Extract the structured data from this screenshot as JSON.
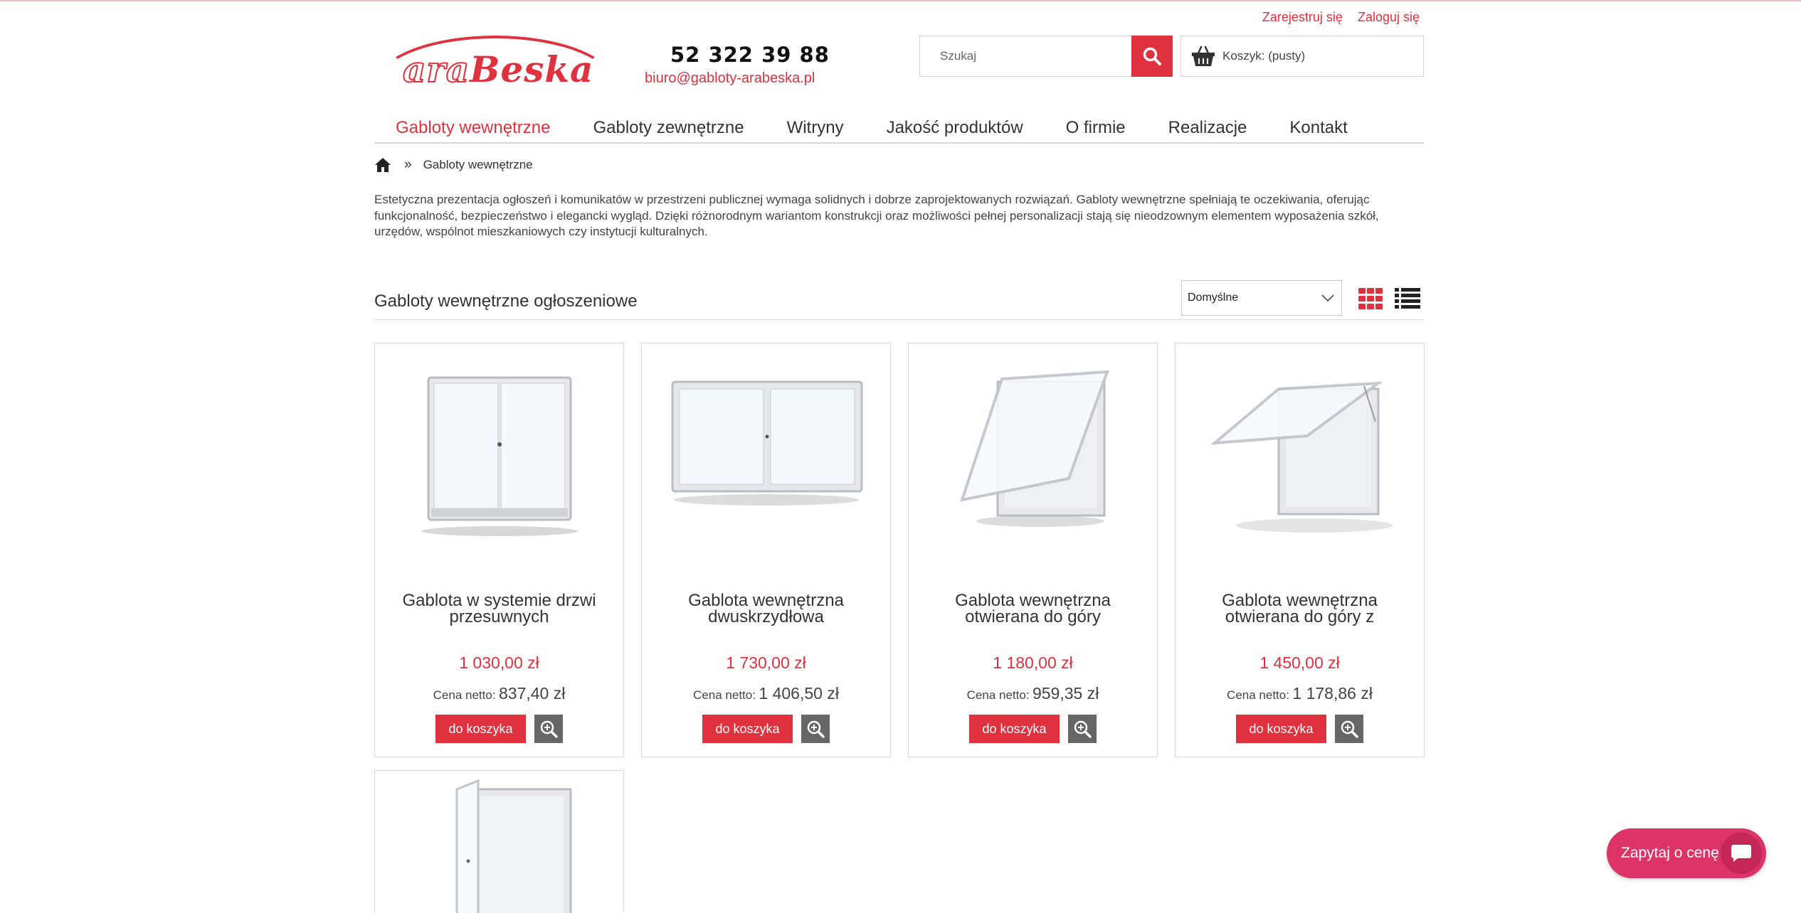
{
  "header": {
    "register_link": "Zarejestruj się",
    "login_link": "Zaloguj się",
    "logo_prefix": "ara",
    "logo_main": "Beska",
    "phone": "52 322 39 88",
    "email": "biuro@gabloty-arabeska.pl",
    "search_placeholder": "Szukaj",
    "cart_label": "Koszyk: (pusty)"
  },
  "nav": {
    "items": [
      {
        "label": "Gabloty wewnętrzne"
      },
      {
        "label": "Gabloty zewnętrzne"
      },
      {
        "label": "Witryny"
      },
      {
        "label": "Jakość produktów"
      },
      {
        "label": "O firmie"
      },
      {
        "label": "Realizacje"
      },
      {
        "label": "Kontakt"
      }
    ],
    "active": "Gabloty wewnętrzne"
  },
  "breadcrumb": {
    "separator": "»",
    "current": "Gabloty wewnętrzne"
  },
  "description": "Estetyczna prezentacja ogłoszeń i komunikatów w przestrzeni publicznej wymaga solidnych i dobrze zaprojektowanych rozwiązań. Gabloty wewnętrzne spełniają te oczekiwania, oferując funkcjonalność, bezpieczeństwo i elegancki wygląd. Dzięki różnorodnym wariantom konstrukcji oraz możliwości pełnej personalizacji stają się nieodzownym elementem wyposażenia szkół, urzędów, wspólnot mieszkaniowych czy instytucji kulturalnych.",
  "listing": {
    "title": "Gabloty wewnętrzne ogłoszeniowe",
    "sort_value": "Domyślne",
    "netto_label": "Cena netto:",
    "buy_label": "do koszyka"
  },
  "products": [
    {
      "name": "Gablota w systemie drzwi przesuwnych",
      "price": "1 030,00 zł",
      "netto": "837,40 zł"
    },
    {
      "name": "Gablota wewnętrzna dwuskrzydłowa",
      "price": "1 730,00 zł",
      "netto": "1 406,50 zł"
    },
    {
      "name": "Gablota wewnętrzna otwierana do góry",
      "price": "1 180,00 zł",
      "netto": "959,35 zł"
    },
    {
      "name": "Gablota wewnętrzna otwierana do góry z",
      "price": "1 450,00 zł",
      "netto": "1 178,86 zł"
    }
  ],
  "chat": {
    "label": "Zapytaj o cenę"
  },
  "colors": {
    "accent": "#e0313f",
    "chat": "#dd3468"
  }
}
